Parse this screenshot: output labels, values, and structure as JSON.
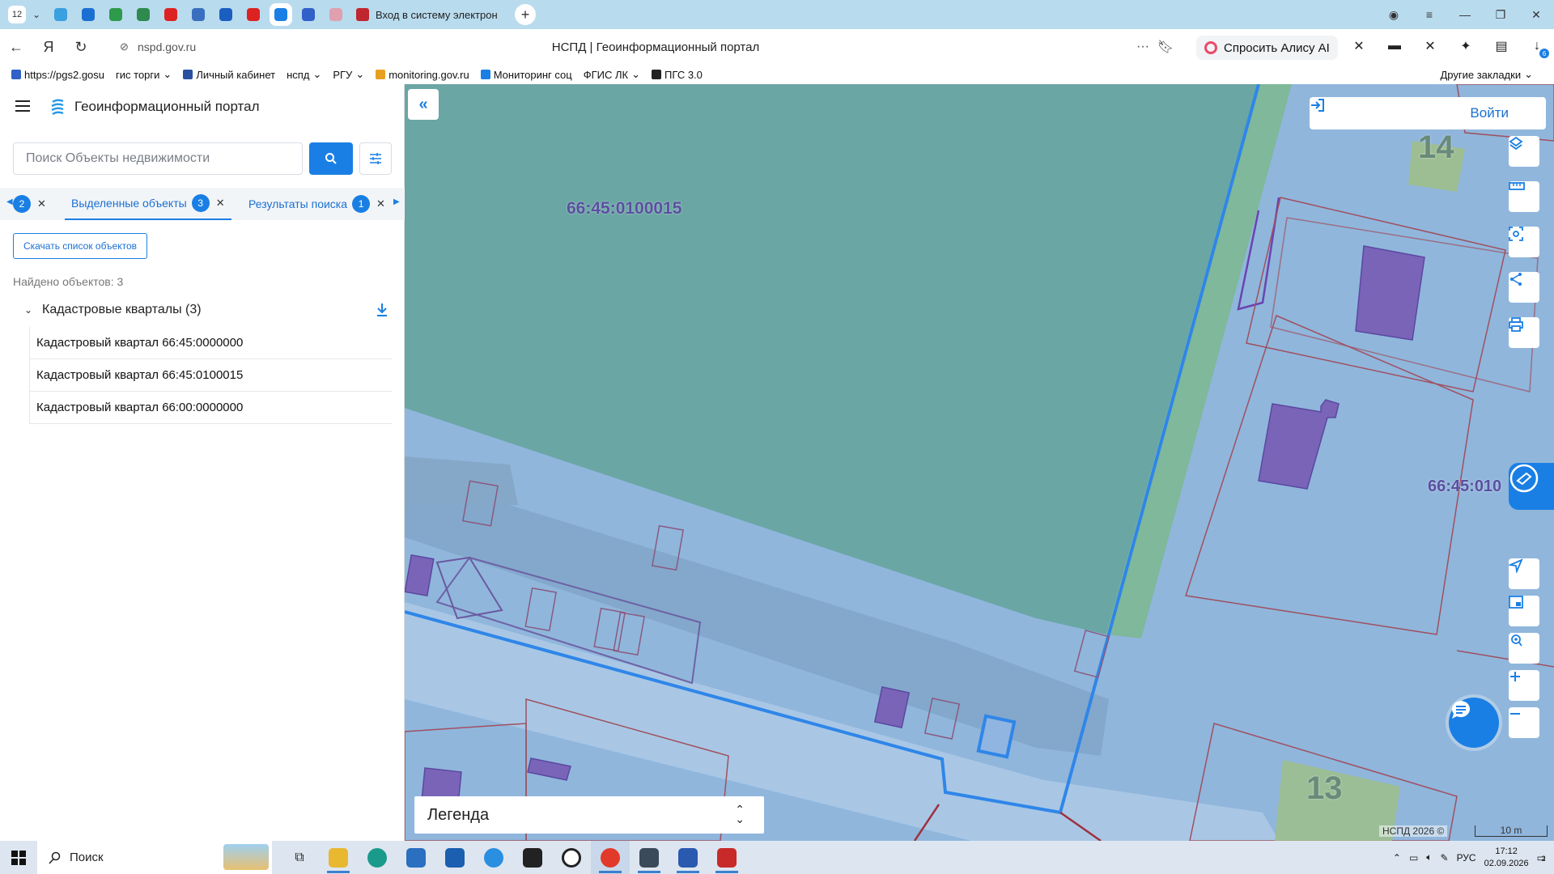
{
  "browser": {
    "tab_count": "12",
    "active_tab_title": "Вход в систему электрон",
    "url_host": "nspd.gov.ru",
    "page_title": "НСПД | Геоинформационный портал",
    "alice_label": "Спросить Алису AI",
    "extension_badge": "6",
    "pinned_tab_colors": [
      "#3aa0e0",
      "#1a6fd2",
      "#2e9a4b",
      "#2e8a4e",
      "#d22",
      "#3a6fc0",
      "#1a5fc0",
      "#d22",
      "#1a7fe4",
      "#3060c8",
      "#e0a0b0"
    ]
  },
  "bookmarks": {
    "items": [
      {
        "label": "https://pgs2.gosu",
        "color": "#3060c8",
        "has_menu": false
      },
      {
        "label": "гис торги",
        "color": "",
        "has_menu": true
      },
      {
        "label": "Личный кабинет",
        "color": "#2a50a0",
        "has_menu": false
      },
      {
        "label": "нспд",
        "color": "",
        "has_menu": true
      },
      {
        "label": "РГУ",
        "color": "",
        "has_menu": true
      },
      {
        "label": "monitoring.gov.ru",
        "color": "#e8a020",
        "has_menu": false
      },
      {
        "label": "Мониторинг соц",
        "color": "#1a7fe4",
        "has_menu": false
      },
      {
        "label": "ФГИС ЛК",
        "color": "",
        "has_menu": true
      },
      {
        "label": "ПГС 3.0",
        "color": "#222",
        "has_menu": false
      }
    ],
    "other": "Другие закладки"
  },
  "app": {
    "name": "Геоинформационный портал",
    "search_placeholder": "Поиск Объекты недвижимости",
    "tabs": [
      {
        "label": "",
        "count": "2"
      },
      {
        "label": "Выделенные объекты",
        "count": "3"
      },
      {
        "label": "Результаты поиска",
        "count": "1"
      }
    ],
    "download_list_label": "Скачать список объектов",
    "found_text": "Найдено объектов: 3",
    "group_label": "Кадастровые кварталы (3)",
    "items": [
      "Кадастровый квартал 66:45:0000000",
      "Кадастровый квартал 66:45:0100015",
      "Кадастровый квартал 66:00:0000000"
    ]
  },
  "map": {
    "login_label": "Войти",
    "labels": {
      "quarter_main": "66:45:0100015",
      "quarter_right": "66:45:010",
      "house_14": "14",
      "house_13": "13"
    },
    "legend_label": "Легенда",
    "attribution": "НСПД 2026 ©",
    "scale_label": "10 m",
    "tools": [
      "layers-icon",
      "ruler-icon",
      "select-area-icon",
      "share-icon",
      "print-icon"
    ],
    "nav_tools": [
      "locate-icon",
      "minimap-icon",
      "geolocation-icon",
      "zoom-in-icon",
      "zoom-out-icon"
    ]
  },
  "taskbar": {
    "search_label": "Поиск",
    "language": "РУС",
    "time": "17:12",
    "date": "02.09.2026",
    "notification_count": "2"
  }
}
